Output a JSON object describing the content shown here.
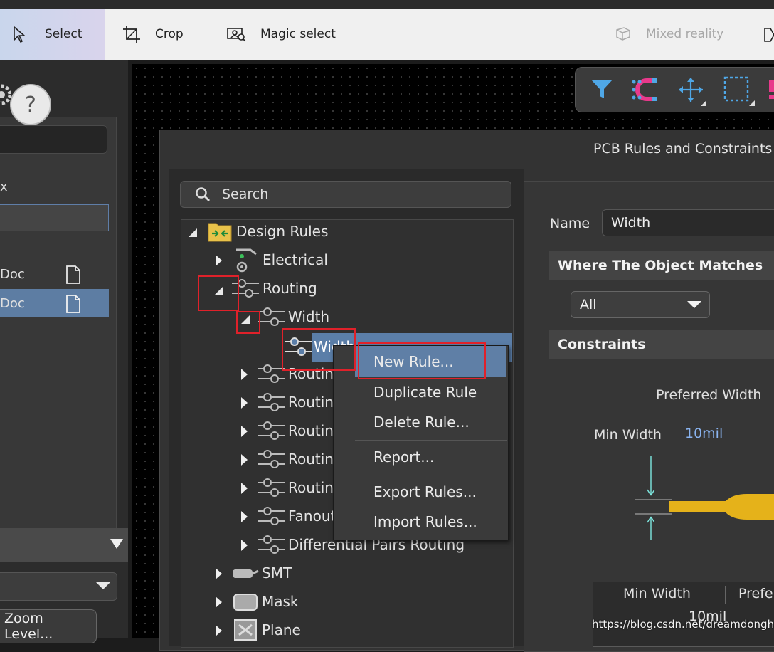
{
  "toolbar": {
    "select": "Select",
    "crop": "Crop",
    "magic_select": "Magic select",
    "mixed_reality": "Mixed reality"
  },
  "left_panel": {
    "help": "?",
    "x_label": "x",
    "doc1": "Doc",
    "doc2": "Doc",
    "zoom_button": "Zoom Level..."
  },
  "dialog": {
    "title": "PCB Rules and Constraints",
    "search_placeholder": "Search",
    "tree": {
      "root": "Design Rules",
      "electrical": "Electrical",
      "routing": "Routing",
      "width": "Width",
      "width_rule": "Width",
      "routing_children": [
        "Routin",
        "Routin",
        "Routin",
        "Routin",
        "Routin",
        "Fanout",
        "Differential Pairs Routing"
      ],
      "smt": "SMT",
      "mask": "Mask",
      "plane": "Plane"
    },
    "context_menu": {
      "new_rule": "New Rule...",
      "duplicate_rule": "Duplicate Rule",
      "delete_rule": "Delete Rule...",
      "report": "Report...",
      "export_rules": "Export Rules...",
      "import_rules": "Import Rules..."
    },
    "right": {
      "name_label": "Name",
      "name_value": "Width",
      "where_header": "Where The Object Matches",
      "scope_value": "All",
      "constraints_header": "Constraints",
      "preferred_width": "Preferred Width",
      "min_width_label": "Min Width",
      "min_width_value": "10mil",
      "table_header_min": "Min Width",
      "table_header_pref": "Prefe",
      "table_value": "10mil"
    }
  },
  "watermark": "https://blog.csdn.net/dreamdonghui"
}
